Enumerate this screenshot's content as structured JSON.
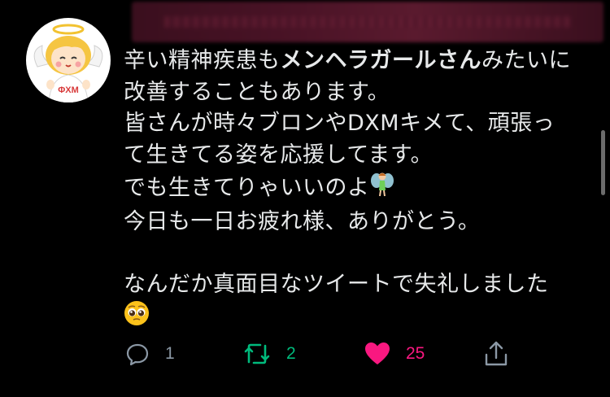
{
  "tweet": {
    "lines": [
      {
        "pre": "辛い精神疾患も",
        "bold": "メンヘラガールさん",
        "post": "みたいに"
      },
      {
        "text": "改善することもあります。"
      },
      {
        "text": "皆さんが時々ブロンやDXMキメて、頑張っ"
      },
      {
        "text": "て生きてる姿を応援してます。"
      },
      {
        "text": "でも生きてりゃいいのよ",
        "emoji": "fairy-emoji"
      },
      {
        "text": "今日も一日お疲れ様、ありがとう。"
      },
      {
        "text": ""
      },
      {
        "text": "なんだか真面目なツイートで失礼しました"
      }
    ],
    "trailing_emoji": "pleading-face-emoji",
    "avatar_text": "ΦXM"
  },
  "actions": {
    "reply_count": "1",
    "retweet_count": "2",
    "like_count": "25"
  },
  "colors": {
    "retweet": "#00ba7c",
    "like": "#f91880",
    "muted": "#8b98a5"
  }
}
